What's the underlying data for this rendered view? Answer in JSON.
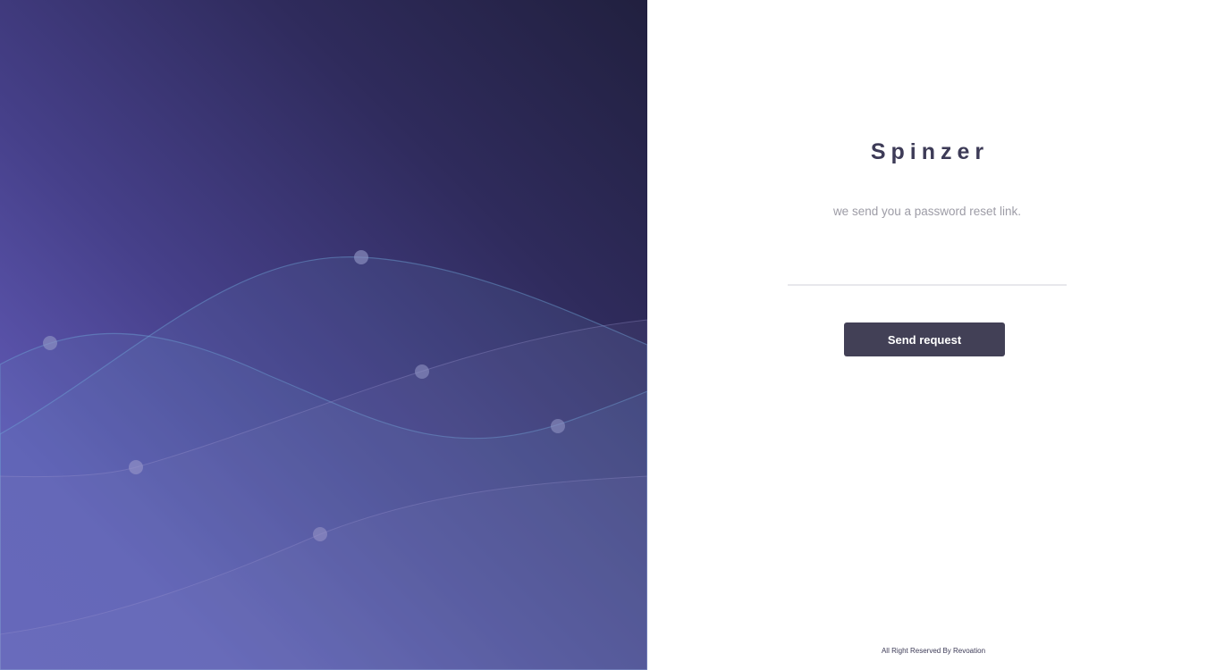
{
  "brand": {
    "name": "Spinzer"
  },
  "reset_form": {
    "subtitle": "we send you a password reset link.",
    "email_value": "",
    "email_placeholder": "",
    "submit_label": "Send request"
  },
  "footer": {
    "text": "All Right Reserved By Revoation"
  },
  "colors": {
    "panel_gradient_dark": "#21203f",
    "panel_gradient_light": "#6058b6",
    "button_bg": "#424056",
    "brand_text": "#3d3b57"
  }
}
